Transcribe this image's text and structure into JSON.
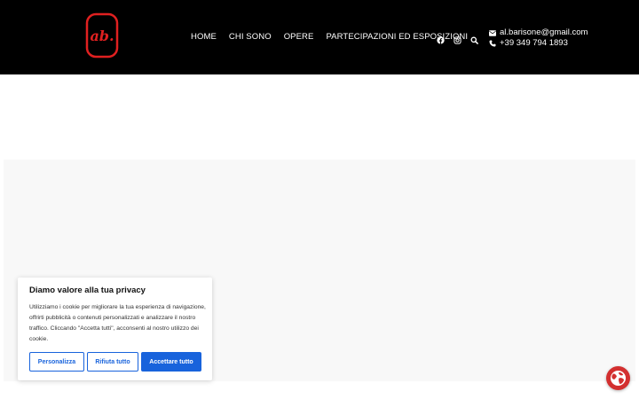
{
  "header": {
    "logo_text": "ab.",
    "nav": [
      {
        "label": "HOME"
      },
      {
        "label": "CHI SONO"
      },
      {
        "label": "OPERE"
      },
      {
        "label": "PARTECIPAZIONI ED ESPOSIZIONI"
      }
    ],
    "social_icons": [
      "facebook-icon",
      "instagram-icon",
      "search-icon"
    ],
    "contact": {
      "email": "al.barisone@gmail.com",
      "phone": "+39 349 794 1893"
    }
  },
  "cookie_banner": {
    "title": "Diamo valore alla tua privacy",
    "text": "Utilizziamo i cookie per migliorare la tua esperienza di navigazione, offrirti pubblicità o contenuti personalizzati e analizzare il nostro traffico. Cliccando \"Accetta tutti\", acconsenti al nostro utilizzo dei cookie.",
    "customize_label": "Personalizza",
    "reject_label": "Rifiuta tutto",
    "accept_label": "Accettare tutto"
  },
  "colors": {
    "header_bg": "#000000",
    "logo_red": "#e02020",
    "button_blue": "#1863dc",
    "globe_red": "#d32f2f"
  }
}
